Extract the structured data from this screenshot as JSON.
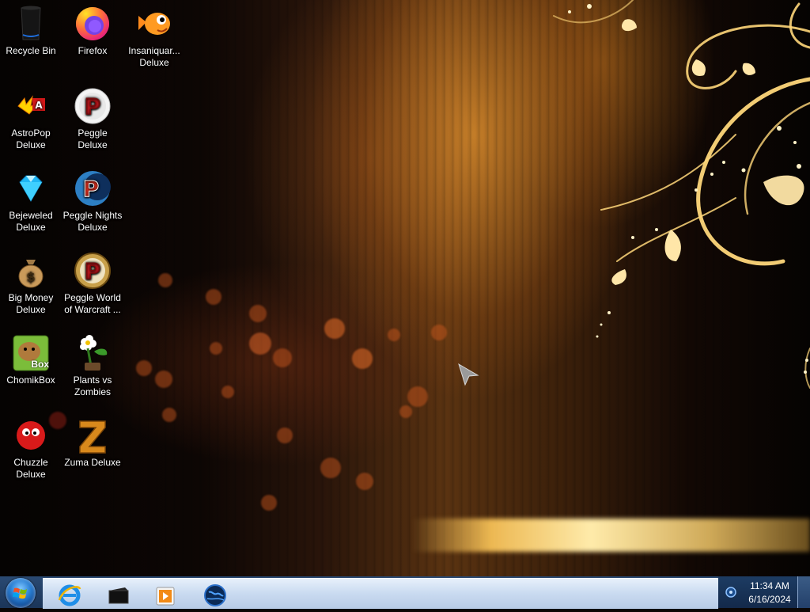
{
  "desktop": {
    "icons": [
      {
        "id": "recycle-bin",
        "label": "Recycle Bin"
      },
      {
        "id": "firefox",
        "label": "Firefox"
      },
      {
        "id": "insaniquarium",
        "label": "Insaniquar... Deluxe"
      },
      {
        "id": "astropop",
        "label": "AstroPop Deluxe"
      },
      {
        "id": "peggle",
        "label": "Peggle Deluxe"
      },
      {
        "id": "bejeweled",
        "label": "Bejeweled Deluxe"
      },
      {
        "id": "peggle-nights",
        "label": "Peggle Nights Deluxe"
      },
      {
        "id": "big-money",
        "label": "Big Money Deluxe"
      },
      {
        "id": "peggle-wow",
        "label": "Peggle World of Warcraft ..."
      },
      {
        "id": "chomikbox",
        "label": "ChomikBox"
      },
      {
        "id": "plants-vs-zombies",
        "label": "Plants vs Zombies"
      },
      {
        "id": "chuzzle",
        "label": "Chuzzle Deluxe"
      },
      {
        "id": "zuma",
        "label": "Zuma Deluxe"
      }
    ],
    "chomikbox_badge": "Box"
  },
  "taskbar": {
    "pinned": [
      {
        "name": "internet-explorer-icon"
      },
      {
        "name": "library-icon"
      },
      {
        "name": "media-player-icon"
      },
      {
        "name": "globe-app-icon"
      }
    ],
    "clock": {
      "time": "11:34 AM",
      "date": "6/16/2024"
    }
  },
  "colors": {
    "taskbar_light": "#c9daf0",
    "wallpaper_gold": "#f5c25a"
  }
}
